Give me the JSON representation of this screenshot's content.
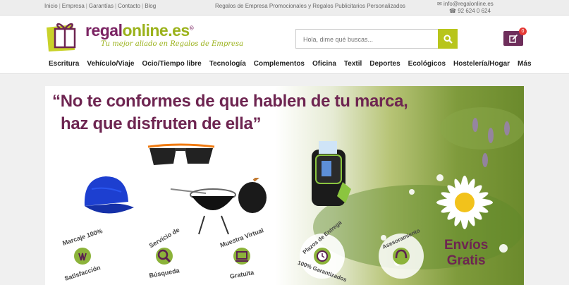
{
  "topbar": {
    "links": [
      "Inicio",
      "Empresa",
      "Garantías",
      "Contacto",
      "Blog"
    ],
    "tagline": "Regalos de Empresa Promocionales y Regalos Publicitarios Personalizados",
    "email": "info@regalonline.es",
    "phone": "92 624 0 624"
  },
  "header": {
    "logo_main": "regal",
    "logo_accent": "online.es",
    "logo_mark": "©",
    "logo_tagline": "Tu mejor aliado en Regalos de Empresa",
    "search_placeholder": "Hola, dime qué buscas...",
    "quote_count": "0"
  },
  "nav": [
    "Escritura",
    "Vehículo/Viaje",
    "Ocio/Tiempo libre",
    "Tecnología",
    "Complementos",
    "Oficina",
    "Textil",
    "Deportes",
    "Ecológicos",
    "Hostelería/Hogar",
    "Más"
  ],
  "banner": {
    "quote_line1": "“No te conformes de que hablen de tu marca,",
    "quote_line2": "haz que disfruten de ella”",
    "envios_line1": "Envíos",
    "envios_line2": "Gratis",
    "seals": [
      {
        "top": "Marcaje 100%",
        "bottom": "Satisfacción"
      },
      {
        "top": "Servicio de",
        "bottom": "Búsqueda"
      },
      {
        "top": "Muestra Virtual",
        "bottom": "Gratuita"
      },
      {
        "top": "Plazos de Entrega",
        "bottom": "100% Garantizados"
      },
      {
        "top": "Asesoramiento",
        "bottom": ""
      }
    ]
  },
  "colors": {
    "brand_purple": "#6e2551",
    "brand_green": "#9bb21b",
    "search_button": "#b8c51b"
  }
}
